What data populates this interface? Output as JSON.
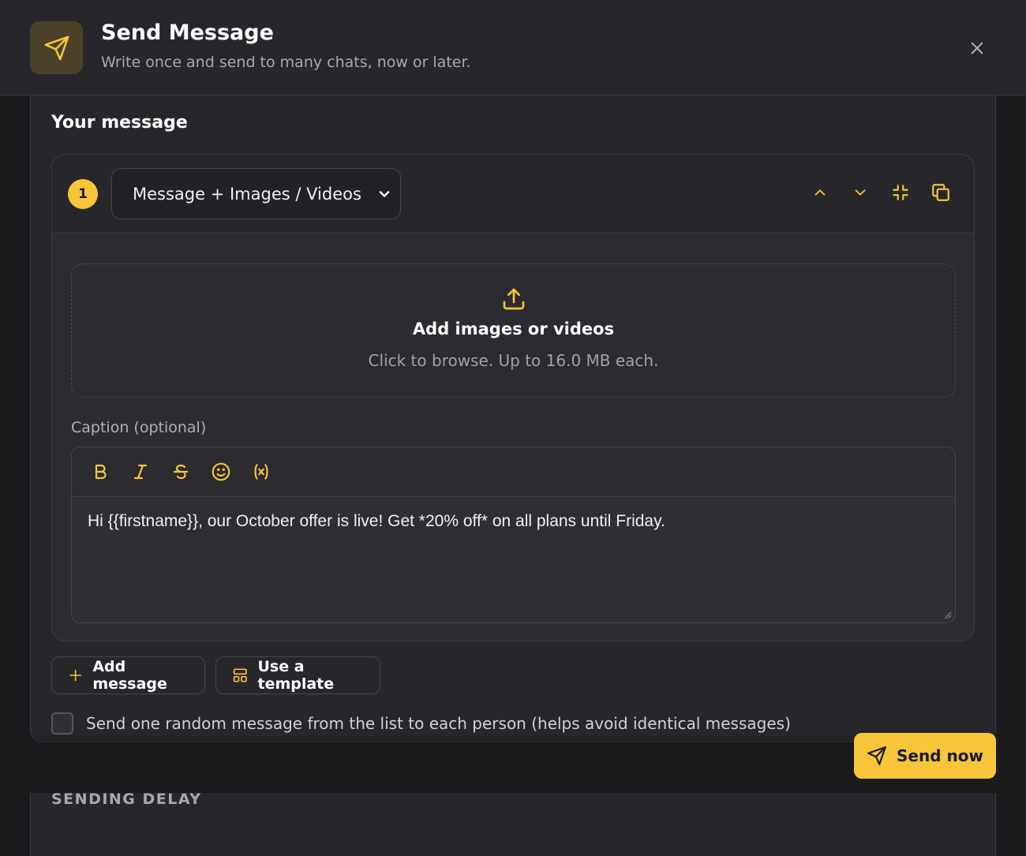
{
  "header": {
    "title": "Send Message",
    "subtitle": "Write once and send to many chats, now or later.",
    "icon": "send-icon",
    "accent": "#f7c53a"
  },
  "message_section": {
    "title": "Your message",
    "card": {
      "step": "1",
      "type_select": {
        "selected": "Message + Images / Videos"
      },
      "tools": [
        "move-up-icon",
        "move-down-icon",
        "collapse-icon",
        "duplicate-icon"
      ],
      "dropzone": {
        "title": "Add images or videos",
        "subtitle": "Click to browse. Up to 16.0 MB each."
      },
      "caption": {
        "label": "Caption (optional)",
        "toolbar": [
          "bold-icon",
          "italic-icon",
          "strikethrough-icon",
          "emoji-icon",
          "variable-icon"
        ],
        "value": "Hi {{firstname}}, our October offer is live! Get *20% off* on all plans until Friday."
      }
    }
  },
  "actions": {
    "add_message": "Add message",
    "use_template": "Use a template"
  },
  "random_option": {
    "label": "Send one random message from the list to each person (helps avoid identical messages)",
    "checked": false
  },
  "delay_section": {
    "title": "SENDING DELAY"
  },
  "send_button": {
    "label": "Send now"
  }
}
